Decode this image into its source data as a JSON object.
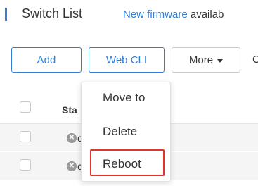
{
  "header": {
    "title": "Switch List",
    "notice_link": "New firmware",
    "notice_rest": " availab"
  },
  "toolbar": {
    "add_label": "Add",
    "webcli_label": "Web CLI",
    "more_label": "More",
    "cut_text": "C"
  },
  "table": {
    "columns": [
      "Sta"
    ],
    "rows": [
      {
        "status_text": "c"
      },
      {
        "status_text": "c"
      }
    ]
  },
  "menu": {
    "items": [
      "Move to",
      "Delete",
      "Reboot"
    ],
    "highlighted": "Reboot",
    "highlight_color": "#e5322d"
  },
  "colors": {
    "accent": "#2f7ed8",
    "row_bg": "#f5f5f5"
  }
}
